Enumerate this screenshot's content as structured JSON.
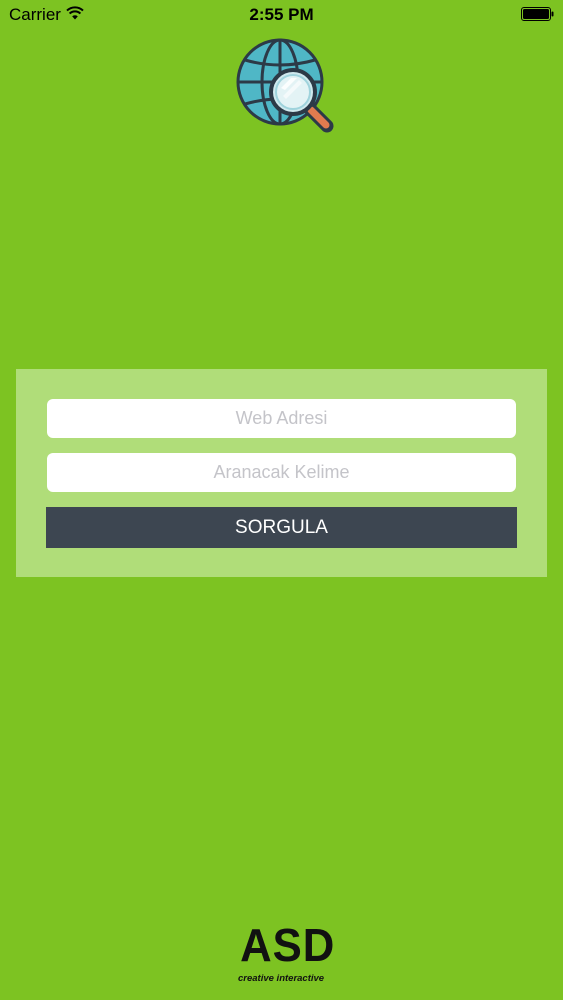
{
  "status_bar": {
    "carrier": "Carrier",
    "time": "2:55 PM",
    "wifi_icon": "wifi-icon",
    "battery_icon": "battery-icon"
  },
  "logo": {
    "icon": "globe-magnifier-icon",
    "colors": {
      "globe": "#4fb7c6",
      "outline": "#2c3a47",
      "lens": "#cfe9ee",
      "handle": "#e07b4f"
    }
  },
  "form": {
    "web_address_placeholder": "Web Adresi",
    "web_address_value": "",
    "keyword_placeholder": "Aranacak Kelime",
    "keyword_value": "",
    "submit_label": "SORGULA"
  },
  "brand": {
    "logo_text": "ASD",
    "tagline": "creative interactive"
  },
  "colors": {
    "background": "#7dc322",
    "panel": "#b0dd79",
    "button": "#3d4651",
    "button_text": "#ffffff",
    "placeholder": "#c4c4c9"
  }
}
